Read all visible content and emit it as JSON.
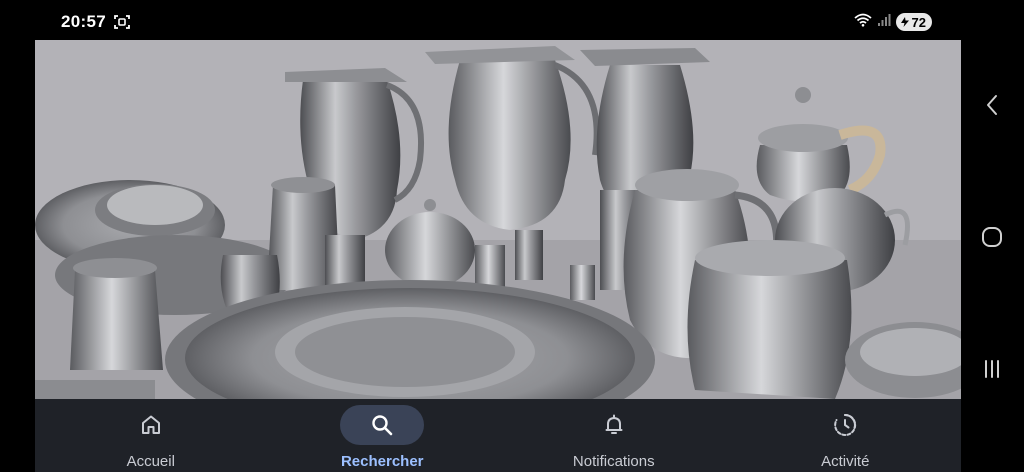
{
  "status_bar": {
    "time": "20:57",
    "battery_level": "72"
  },
  "content": {
    "image_subject": "pewter-tableware-collection"
  },
  "bottom_nav": {
    "items": [
      {
        "label": "Accueil",
        "icon": "home-icon",
        "active": false
      },
      {
        "label": "Rechercher",
        "icon": "search-icon",
        "active": true
      },
      {
        "label": "Notifications",
        "icon": "bell-icon",
        "active": false
      },
      {
        "label": "Activité",
        "icon": "activity-icon",
        "active": false
      }
    ]
  },
  "system_nav": {
    "buttons": [
      "back-icon",
      "home-circle-icon",
      "recents-icon"
    ]
  },
  "colors": {
    "nav_background": "#1f2228",
    "active_pill": "#3a4357",
    "active_label": "#9cc0ff",
    "inactive_label": "#c9ccd3"
  }
}
